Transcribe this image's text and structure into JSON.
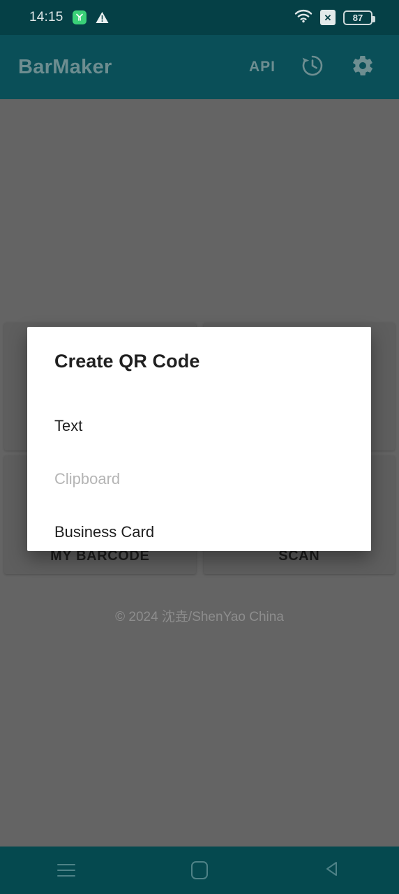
{
  "status_bar": {
    "time": "14:15",
    "app_icon_name": "green-app-icon",
    "warning_icon_name": "warning-triangle-icon",
    "wifi_icon_name": "wifi-icon",
    "no_sim_label": "✕",
    "battery_level": "87",
    "background_color": "#054046"
  },
  "app_bar": {
    "title": "BarMaker",
    "api_label": "API",
    "history_icon_name": "history-icon",
    "settings_icon_name": "gear-icon",
    "background_color": "#0a4f58",
    "title_color": "#6d8d90"
  },
  "background": {
    "scrim_color": "#646464",
    "cards_top": [
      {
        "label": ""
      },
      {
        "label": ""
      }
    ],
    "cards_bottom": [
      {
        "label": "MY BARCODE"
      },
      {
        "label": "SCAN"
      }
    ],
    "copyright": "© 2024 沈垚/ShenYao China"
  },
  "dialog": {
    "title": "Create QR Code",
    "items": [
      {
        "label": "Text",
        "disabled": false
      },
      {
        "label": "Clipboard",
        "disabled": true
      },
      {
        "label": "Business Card",
        "disabled": false
      }
    ],
    "background_color": "#ffffff"
  },
  "nav_bar": {
    "recents_icon_name": "menu-icon",
    "home_icon_name": "home-square-icon",
    "back_icon_name": "back-triangle-icon",
    "background_color": "#05494f"
  }
}
